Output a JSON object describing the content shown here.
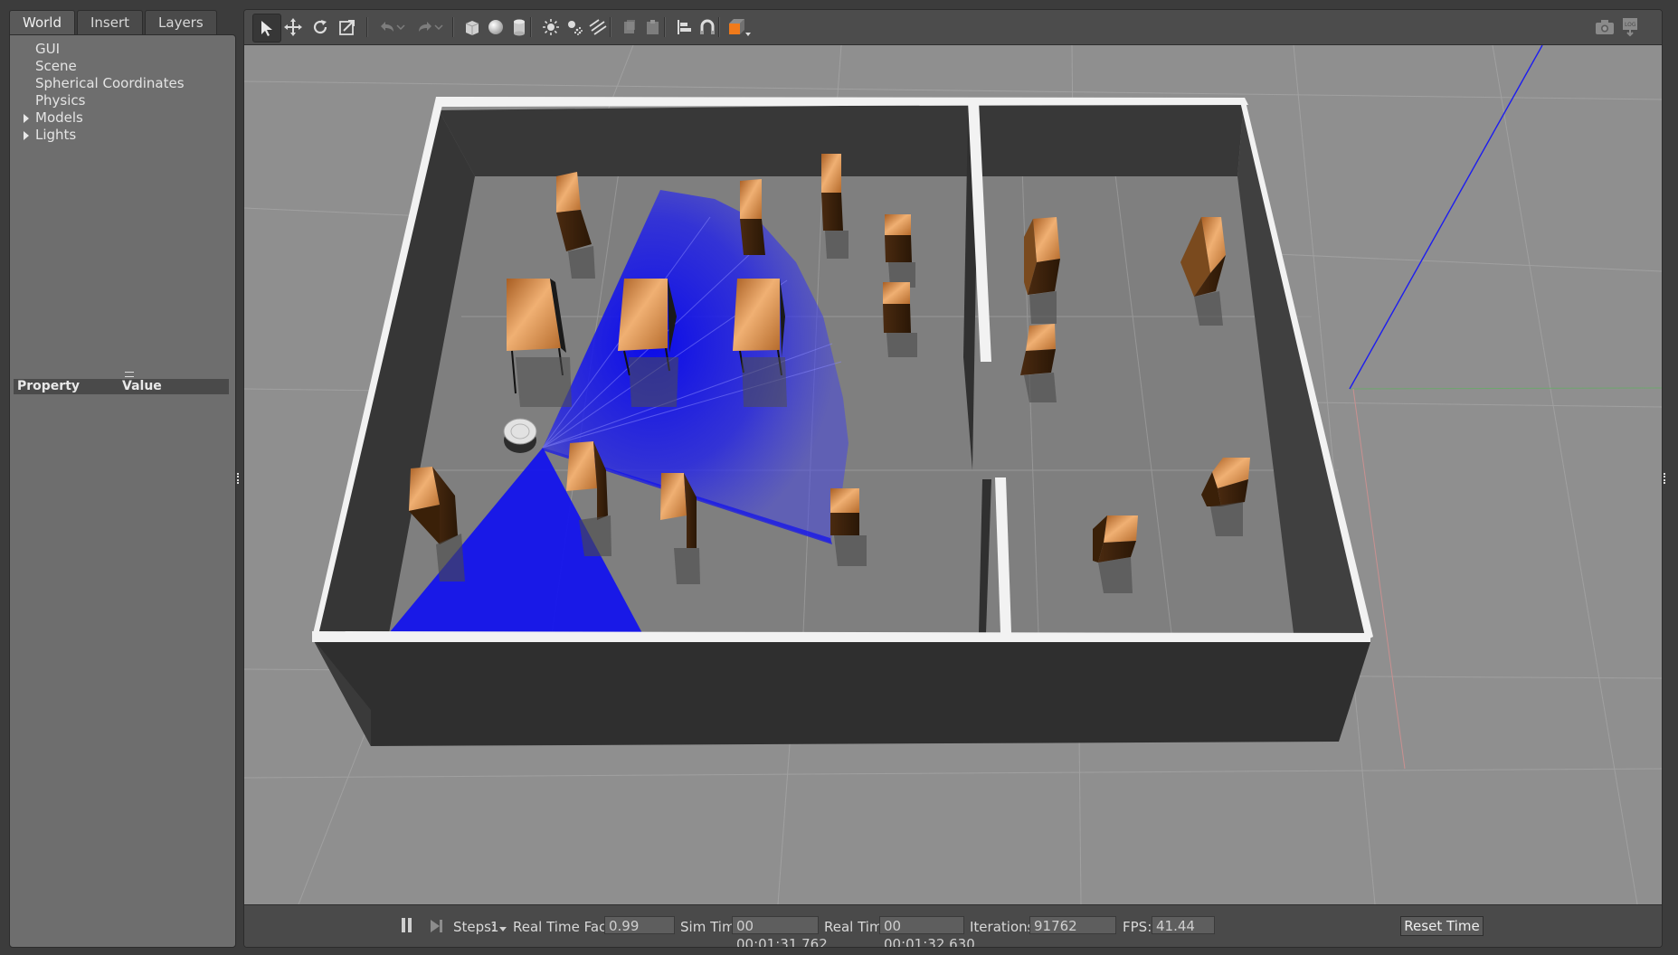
{
  "left_panel": {
    "tabs": [
      {
        "label": "World",
        "active": true
      },
      {
        "label": "Insert",
        "active": false
      },
      {
        "label": "Layers",
        "active": false
      }
    ],
    "tree": [
      {
        "label": "GUI",
        "expandable": false
      },
      {
        "label": "Scene",
        "expandable": false
      },
      {
        "label": "Spherical Coordinates",
        "expandable": false
      },
      {
        "label": "Physics",
        "expandable": false
      },
      {
        "label": "Models",
        "expandable": true
      },
      {
        "label": "Lights",
        "expandable": true
      }
    ],
    "property_header": {
      "property": "Property",
      "value": "Value"
    }
  },
  "toolbar": {
    "tools": [
      "select-arrow-icon",
      "translate-icon",
      "rotate-icon",
      "scale-icon",
      "undo-icon",
      "redo-icon",
      "box-icon",
      "sphere-icon",
      "cylinder-icon",
      "point-light-icon",
      "spot-light-icon",
      "directional-light-icon",
      "copy-icon",
      "paste-icon",
      "align-icon",
      "snap-icon",
      "view-angle-icon",
      "screenshot-icon",
      "log-icon"
    ],
    "accent_color": "#f07a1a",
    "active_tool": "select-arrow-icon"
  },
  "status": {
    "steps_label": "Steps:",
    "steps_value": "1",
    "rtf_label": "Real Time Factor:",
    "rtf_value": "0.99",
    "sim_time_label": "Sim Time:",
    "sim_time_value": "00 00:01:31.762",
    "real_time_label": "Real Time:",
    "real_time_value": "00 00:01:32.630",
    "iterations_label": "Iterations:",
    "iterations_value": "91762",
    "fps_label": "FPS:",
    "fps_value": "41.44",
    "reset_label": "Reset Time"
  },
  "scene": {
    "laser_color": "#1010f0",
    "wall_color": "#f2f2f2",
    "floor_color": "#7e7e7e",
    "ground_color": "#8f8f8f"
  }
}
